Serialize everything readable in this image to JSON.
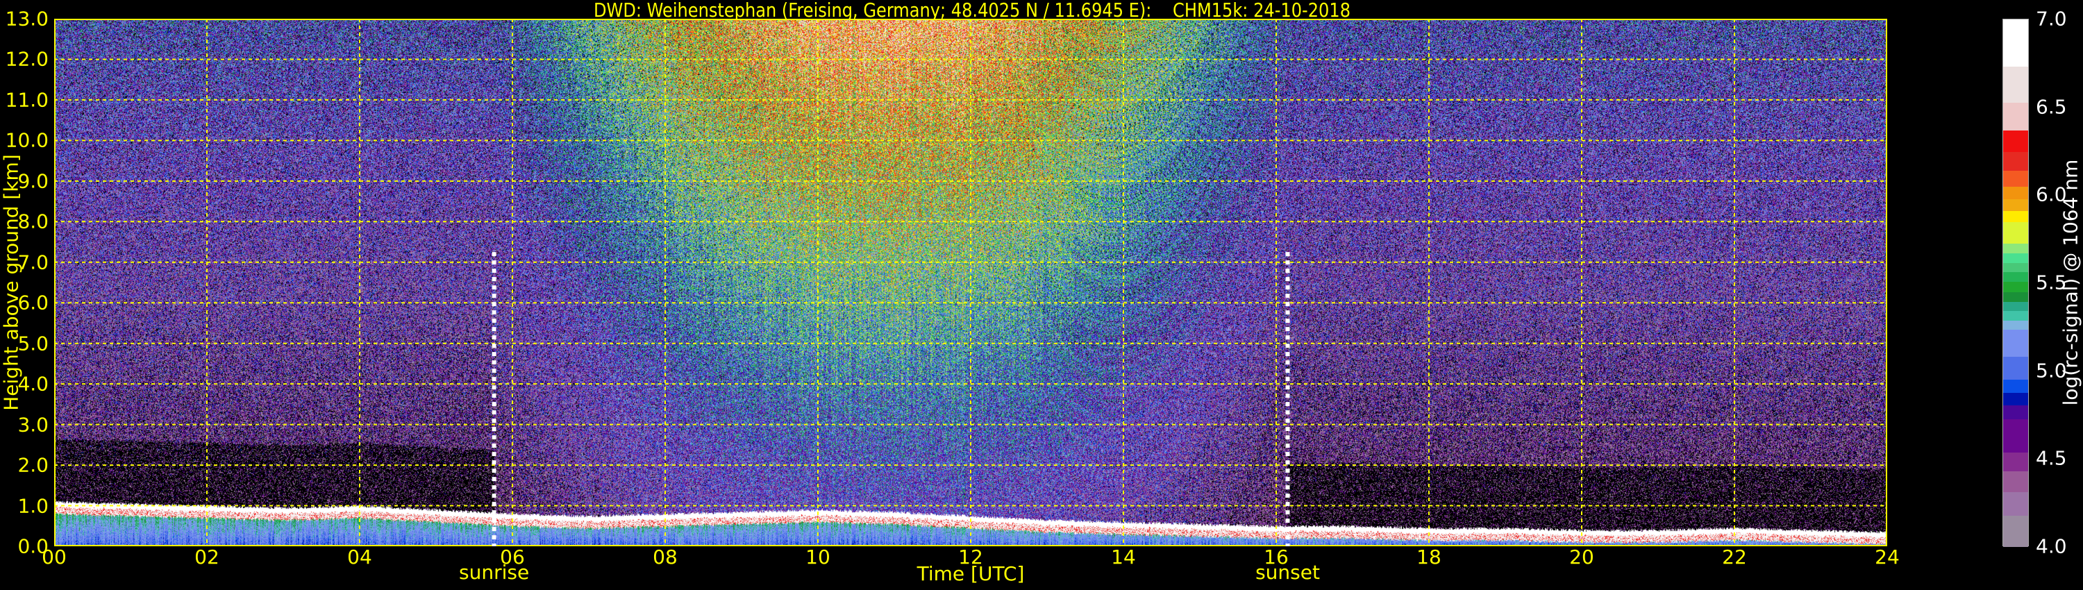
{
  "title": "DWD: Weihenstephan (Freising, Germany; 48.4025 N / 11.6945 E):    CHM15k: 24-10-2018",
  "chart_data": {
    "type": "heatmap",
    "title": "DWD: Weihenstephan (Freising, Germany; 48.4025 N / 11.6945 E):    CHM15k: 24-10-2018",
    "xlabel": "Time [UTC]",
    "ylabel": "Height above ground [km]",
    "xlim": [
      0,
      24
    ],
    "ylim": [
      0,
      13
    ],
    "x_ticks": [
      0,
      2,
      4,
      6,
      8,
      10,
      12,
      14,
      16,
      18,
      20,
      22,
      24
    ],
    "x_tick_labels": [
      "00",
      "02",
      "04",
      "06",
      "08",
      "10",
      "12",
      "14",
      "16",
      "18",
      "20",
      "22",
      "24"
    ],
    "y_ticks": [
      0,
      1,
      2,
      3,
      4,
      5,
      6,
      7,
      8,
      9,
      10,
      11,
      12,
      13
    ],
    "y_tick_labels": [
      "0.0",
      "1.0",
      "2.0",
      "3.0",
      "4.0",
      "5.0",
      "6.0",
      "7.0",
      "8.0",
      "9.0",
      "10.0",
      "11.0",
      "12.0",
      "13.0"
    ],
    "grid": true,
    "markers": [
      {
        "label": "sunrise",
        "hour": 5.76
      },
      {
        "label": "sunset",
        "hour": 16.15
      }
    ],
    "boundary_layer_top_km": {
      "hours": [
        0,
        1,
        2,
        3,
        4,
        5,
        6,
        7,
        8,
        9,
        10,
        11,
        12,
        13,
        14,
        15,
        16,
        17,
        18,
        19,
        20,
        21,
        22,
        23,
        24
      ],
      "values": [
        1.05,
        1.0,
        0.95,
        0.9,
        0.95,
        0.85,
        0.75,
        0.7,
        0.75,
        0.8,
        0.85,
        0.8,
        0.7,
        0.6,
        0.55,
        0.5,
        0.45,
        0.45,
        0.4,
        0.4,
        0.35,
        0.35,
        0.4,
        0.35,
        0.3
      ]
    },
    "colorbar": {
      "label": "log(rc-signal) @ 1064 nm",
      "range": [
        4.0,
        7.0
      ],
      "ticks": [
        "4.0",
        "4.5",
        "5.0",
        "5.5",
        "6.0",
        "6.5",
        "7.0"
      ],
      "bounds": [
        4.0,
        4.178,
        4.311,
        4.429,
        4.536,
        4.725,
        4.805,
        4.876,
        4.951,
        5.084,
        5.238,
        5.29,
        5.345,
        5.397,
        5.449,
        5.509,
        5.564,
        5.616,
        5.674,
        5.727,
        5.85,
        5.914,
        5.979,
        6.054,
        6.142,
        6.249,
        6.371,
        6.532,
        6.736,
        7.0
      ],
      "colors": [
        "#9a8ca0",
        "#9c74a8",
        "#9a5a98",
        "#862c90",
        "#6a0890",
        "#4a0898",
        "#0014b0",
        "#0a50e8",
        "#5070e8",
        "#7890f0",
        "#80b4e0",
        "#40c4a8",
        "#28a888",
        "#1a9038",
        "#20a830",
        "#24b456",
        "#48c878",
        "#4ae090",
        "#8ee87a",
        "#dcf535",
        "#ffeb00",
        "#f2aa10",
        "#f2940e",
        "#f45a22",
        "#e62a22",
        "#f01010",
        "#eec8c8",
        "#ece0df",
        "#ffffff"
      ]
    }
  }
}
